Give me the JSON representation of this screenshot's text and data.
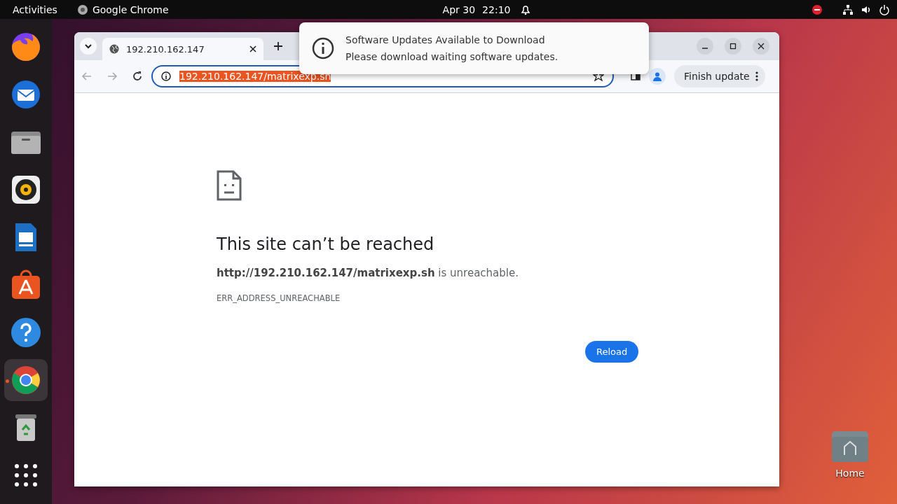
{
  "top_bar": {
    "activities": "Activities",
    "app_name": "Google Chrome",
    "date": "Apr 30",
    "time": "22:10"
  },
  "dock": [
    {
      "kind": "firefox",
      "selected": false
    },
    {
      "kind": "mail",
      "selected": false
    },
    {
      "kind": "files",
      "selected": false
    },
    {
      "kind": "speaker",
      "selected": false
    },
    {
      "kind": "writer",
      "selected": false
    },
    {
      "kind": "store",
      "selected": false
    },
    {
      "kind": "help",
      "selected": false
    },
    {
      "kind": "chrome",
      "selected": true
    },
    {
      "kind": "trash",
      "selected": false
    },
    {
      "kind": "grid",
      "selected": false
    }
  ],
  "browser": {
    "tabs": [
      {
        "title": "192.210.162.147",
        "selected": true
      }
    ],
    "address": {
      "value": "192.210.162.147/matrixexp.sh",
      "highlighted": true
    },
    "update_button": "Finish update",
    "error": {
      "title": "This site can’t be reached",
      "message": "**http://192.210.162.147/matrixexp.sh** is unreachable.",
      "code": "ERR_ADDRESS_UNREACHABLE",
      "button": "Reload"
    }
  },
  "notification": {
    "title": "Software Updates Available to Download",
    "body": "Please download waiting software updates."
  },
  "desktop_icons": [
    {
      "label": "Home"
    }
  ]
}
